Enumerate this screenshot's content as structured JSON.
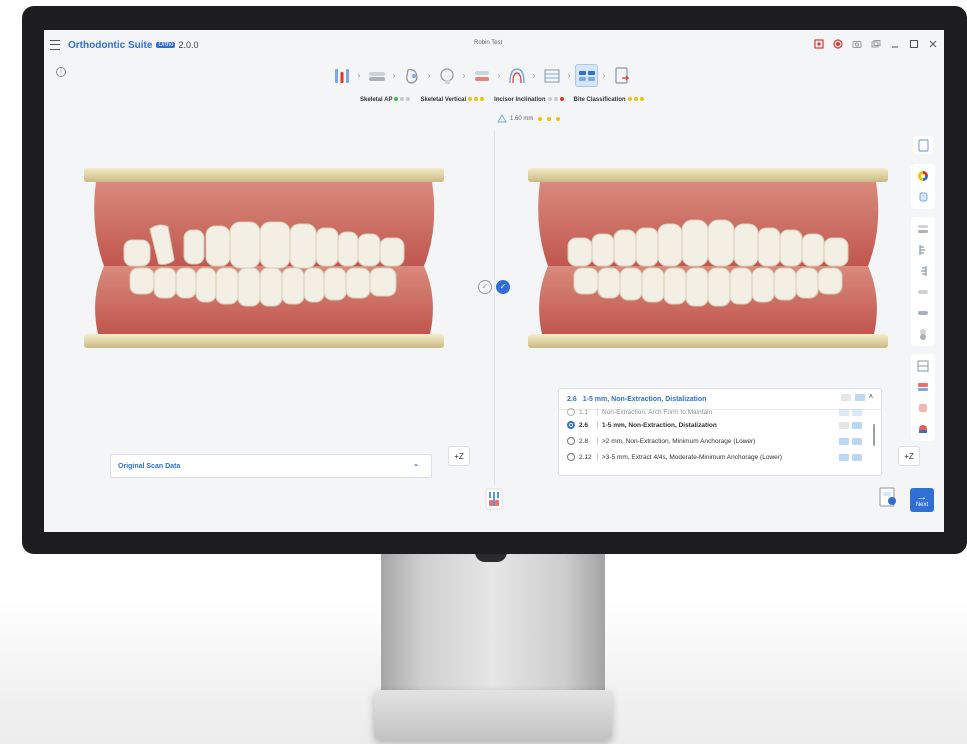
{
  "app": {
    "name": "Orthodontic Suite",
    "badge": "Ortho",
    "version": "2.0.0",
    "window_title": "Robin Test"
  },
  "metrics": [
    {
      "label": "Skeletal AP",
      "dots": [
        "#3fb950",
        "#c9c9c9",
        "#c9c9c9"
      ]
    },
    {
      "label": "Skeletal Vertical",
      "dots": [
        "#f2c200",
        "#f2c200",
        "#f2c200"
      ]
    },
    {
      "label": "Incisor Inclination",
      "dots": [
        "#c9c9c9",
        "#c9c9c9",
        "#e5322d"
      ]
    },
    {
      "label": "Bite Classification",
      "dots": [
        "#f2c200",
        "#f2c200",
        "#f2c200"
      ]
    }
  ],
  "measurement": {
    "value": "1.60 mm",
    "dots": [
      "#f2c200",
      "#f2c200",
      "#f2c200"
    ]
  },
  "scan_dropdown": {
    "selected": "Original Scan Data"
  },
  "z_button_label": "+Z",
  "plan_panel": {
    "selected_code": "2.6",
    "selected_label": "1-5 mm, Non-Extraction, Distalization",
    "options": [
      {
        "code": "1.1",
        "label": "Non-Extraction, Arch Form to Maintain",
        "selected": false
      },
      {
        "code": "2.6",
        "label": "1-5 mm, Non-Extraction, Distalization",
        "selected": true
      },
      {
        "code": "2.8",
        "label": ">2 mm, Non-Extraction, Minimum Anchorage (Lower)",
        "selected": false
      },
      {
        "code": "2.12",
        "label": ">3-5 mm, Extract 4/4s, Moderate-Minimum Anchorage (Lower)",
        "selected": false
      }
    ]
  },
  "next_button_label": "Next",
  "colors": {
    "accent": "#2f6fd6",
    "gum": "#c85a52",
    "tooth": "#f3efe4",
    "base": "#e2d6ad"
  }
}
